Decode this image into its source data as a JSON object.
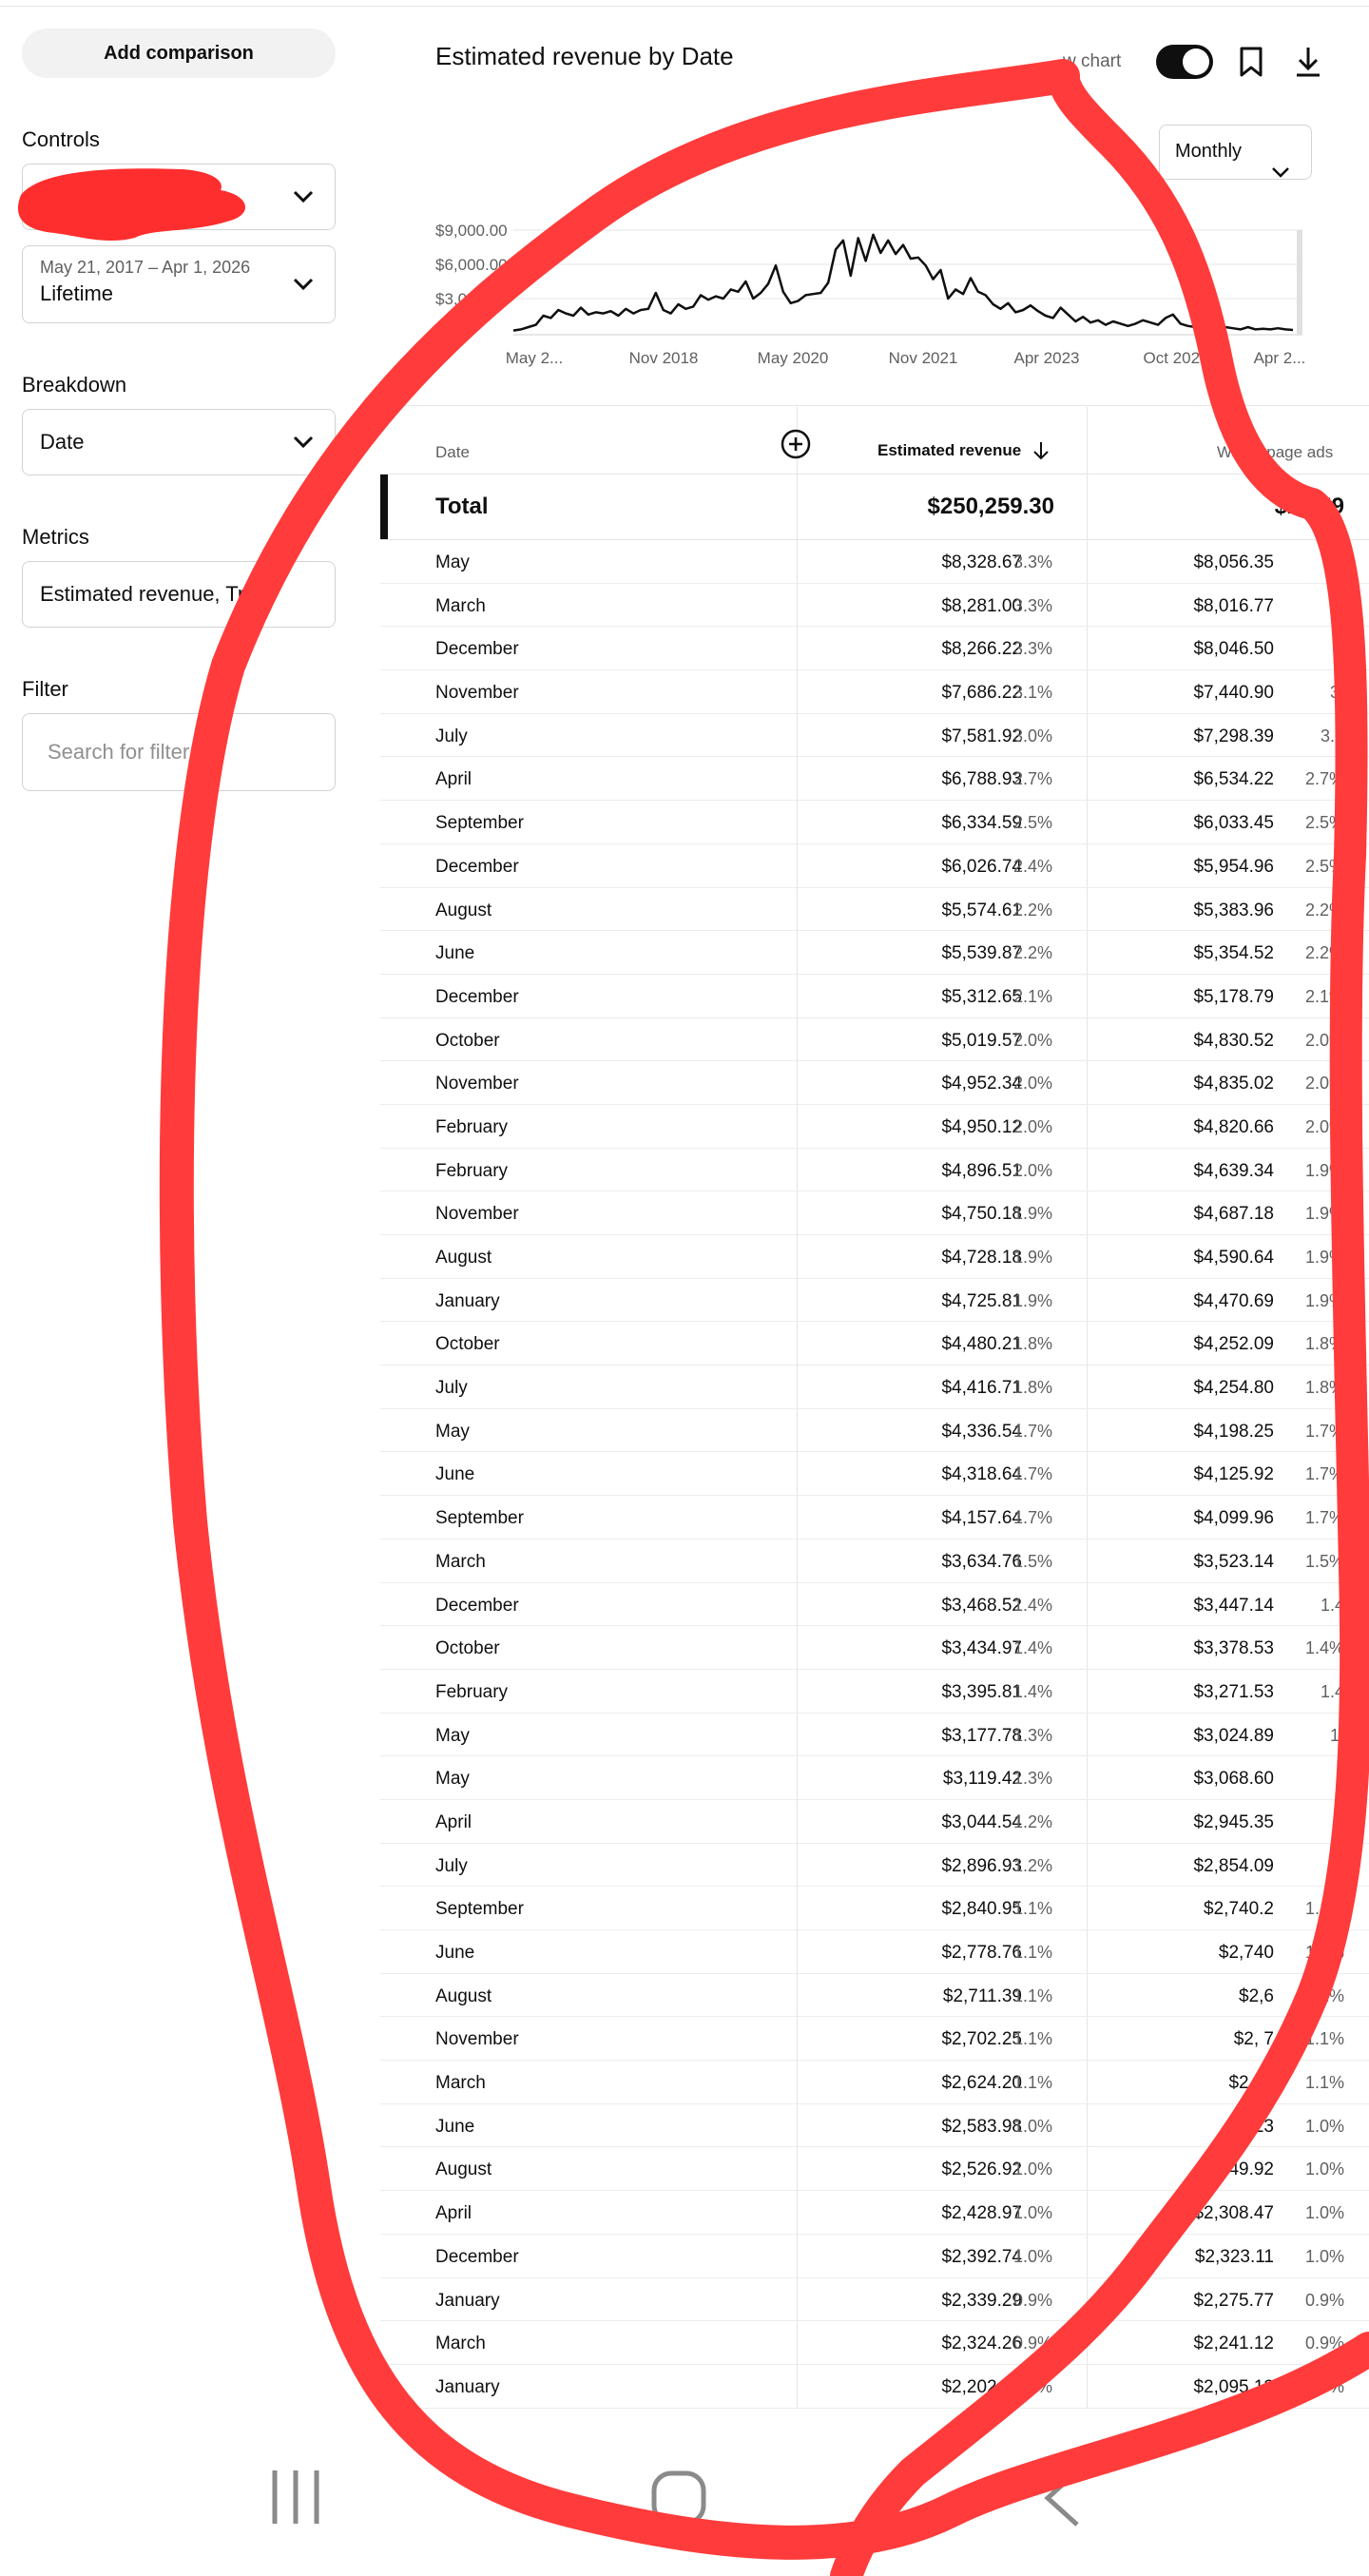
{
  "left": {
    "add_comparison": "Add comparison",
    "controls_title": "Controls",
    "date_range_small": "May 21, 2017 – Apr 1, 2026",
    "date_range_value": "Lifetime",
    "breakdown_title": "Breakdown",
    "breakdown_value": "Date",
    "metrics_title": "Metrics",
    "metrics_value": "Estimated revenue, Tr...",
    "filter_title": "Filter",
    "filter_placeholder": "Search for filter"
  },
  "chart": {
    "title": "Estimated revenue by Date",
    "show_chart_label": "w chart",
    "interval": "Monthly",
    "y_ticks": [
      "$9,000.00",
      "$6,000.00",
      "$3,000"
    ],
    "x_ticks": [
      "May 2...",
      "Nov 2018",
      "May 2020",
      "Nov 2021",
      "Apr 2023",
      "Oct 2024",
      "Apr 2..."
    ]
  },
  "chart_data": {
    "type": "line",
    "title": "Estimated revenue by Date",
    "ylim": [
      0,
      9000
    ],
    "values": [
      200,
      300,
      500,
      700,
      1500,
      1300,
      2000,
      1700,
      1500,
      2200,
      1600,
      1800,
      1700,
      1900,
      1500,
      2100,
      1700,
      2000,
      2100,
      3500,
      2000,
      1700,
      2500,
      2100,
      2300,
      3300,
      2900,
      3200,
      3000,
      3800,
      3600,
      4500,
      3000,
      3500,
      4300,
      5900,
      3600,
      2600,
      2800,
      3300,
      3400,
      3500,
      4400,
      7300,
      8100,
      5000,
      8300,
      6300,
      8600,
      7000,
      8100,
      6900,
      7700,
      6500,
      6600,
      5900,
      4700,
      5500,
      3000,
      3800,
      3400,
      4800,
      3600,
      3300,
      2500,
      2100,
      2600,
      1800,
      2000,
      2400,
      1900,
      1500,
      1300,
      2200,
      1600,
      1000,
      1400,
      900,
      1100,
      700,
      1000,
      800,
      600,
      800,
      1100,
      900,
      700,
      1300,
      1600,
      800,
      600,
      500,
      400,
      500,
      600,
      500,
      400,
      300,
      500,
      300,
      350,
      300,
      400,
      300,
      250
    ]
  },
  "table": {
    "col_date": "Date",
    "col_revenue": "Estimated revenue",
    "col_watch": "Watch page ads",
    "total_label": "Total",
    "total_revenue": "$250,259.30",
    "total_watch": "$24 59",
    "rows": [
      {
        "date": "May",
        "rev": "$8,328.67",
        "revp": "3.3%",
        "w": "$8,056.35",
        "wp": ""
      },
      {
        "date": "March",
        "rev": "$8,281.00",
        "revp": "3.3%",
        "w": "$8,016.77",
        "wp": ""
      },
      {
        "date": "December",
        "rev": "$8,266.22",
        "revp": "3.3%",
        "w": "$8,046.50",
        "wp": ""
      },
      {
        "date": "November",
        "rev": "$7,686.22",
        "revp": "3.1%",
        "w": "$7,440.90",
        "wp": "3."
      },
      {
        "date": "July",
        "rev": "$7,581.92",
        "revp": "3.0%",
        "w": "$7,298.39",
        "wp": "3.0"
      },
      {
        "date": "April",
        "rev": "$6,788.93",
        "revp": "2.7%",
        "w": "$6,534.22",
        "wp": "2.7%"
      },
      {
        "date": "September",
        "rev": "$6,334.59",
        "revp": "2.5%",
        "w": "$6,033.45",
        "wp": "2.5%"
      },
      {
        "date": "December",
        "rev": "$6,026.74",
        "revp": "2.4%",
        "w": "$5,954.96",
        "wp": "2.5%"
      },
      {
        "date": "August",
        "rev": "$5,574.61",
        "revp": "2.2%",
        "w": "$5,383.96",
        "wp": "2.2%"
      },
      {
        "date": "June",
        "rev": "$5,539.87",
        "revp": "2.2%",
        "w": "$5,354.52",
        "wp": "2.2%"
      },
      {
        "date": "December",
        "rev": "$5,312.65",
        "revp": "2.1%",
        "w": "$5,178.79",
        "wp": "2.1%"
      },
      {
        "date": "October",
        "rev": "$5,019.57",
        "revp": "2.0%",
        "w": "$4,830.52",
        "wp": "2.0%"
      },
      {
        "date": "November",
        "rev": "$4,952.34",
        "revp": "2.0%",
        "w": "$4,835.02",
        "wp": "2.0%"
      },
      {
        "date": "February",
        "rev": "$4,950.12",
        "revp": "2.0%",
        "w": "$4,820.66",
        "wp": "2.0%"
      },
      {
        "date": "February",
        "rev": "$4,896.51",
        "revp": "2.0%",
        "w": "$4,639.34",
        "wp": "1.9%"
      },
      {
        "date": "November",
        "rev": "$4,750.18",
        "revp": "1.9%",
        "w": "$4,687.18",
        "wp": "1.9%"
      },
      {
        "date": "August",
        "rev": "$4,728.18",
        "revp": "1.9%",
        "w": "$4,590.64",
        "wp": "1.9%"
      },
      {
        "date": "January",
        "rev": "$4,725.81",
        "revp": "1.9%",
        "w": "$4,470.69",
        "wp": "1.9%"
      },
      {
        "date": "October",
        "rev": "$4,480.21",
        "revp": "1.8%",
        "w": "$4,252.09",
        "wp": "1.8%"
      },
      {
        "date": "July",
        "rev": "$4,416.71",
        "revp": "1.8%",
        "w": "$4,254.80",
        "wp": "1.8%"
      },
      {
        "date": "May",
        "rev": "$4,336.54",
        "revp": "1.7%",
        "w": "$4,198.25",
        "wp": "1.7%"
      },
      {
        "date": "June",
        "rev": "$4,318.64",
        "revp": "1.7%",
        "w": "$4,125.92",
        "wp": "1.7%"
      },
      {
        "date": "September",
        "rev": "$4,157.64",
        "revp": "1.7%",
        "w": "$4,099.96",
        "wp": "1.7%"
      },
      {
        "date": "March",
        "rev": "$3,634.76",
        "revp": "1.5%",
        "w": "$3,523.14",
        "wp": "1.5%"
      },
      {
        "date": "December",
        "rev": "$3,468.52",
        "revp": "1.4%",
        "w": "$3,447.14",
        "wp": "1.4"
      },
      {
        "date": "October",
        "rev": "$3,434.97",
        "revp": "1.4%",
        "w": "$3,378.53",
        "wp": "1.4%"
      },
      {
        "date": "February",
        "rev": "$3,395.81",
        "revp": "1.4%",
        "w": "$3,271.53",
        "wp": "1.4"
      },
      {
        "date": "May",
        "rev": "$3,177.78",
        "revp": "1.3%",
        "w": "$3,024.89",
        "wp": "1."
      },
      {
        "date": "May",
        "rev": "$3,119.42",
        "revp": "1.3%",
        "w": "$3,068.60",
        "wp": ""
      },
      {
        "date": "April",
        "rev": "$3,044.54",
        "revp": "1.2%",
        "w": "$2,945.35",
        "wp": ""
      },
      {
        "date": "July",
        "rev": "$2,896.93",
        "revp": "1.2%",
        "w": "$2,854.09",
        "wp": "%"
      },
      {
        "date": "September",
        "rev": "$2,840.95",
        "revp": "1.1%",
        "w": "$2,740.2",
        "wp": "1.1%"
      },
      {
        "date": "June",
        "rev": "$2,778.76",
        "revp": "1.1%",
        "w": "$2,740",
        "wp": "1.1%"
      },
      {
        "date": "August",
        "rev": "$2,711.39",
        "revp": "1.1%",
        "w": "$2,6",
        "wp": "1.1%"
      },
      {
        "date": "November",
        "rev": "$2,702.25",
        "revp": "1.1%",
        "w": "$2, 7",
        "wp": "1.1%"
      },
      {
        "date": "March",
        "rev": "$2,624.20",
        "revp": "1.1%",
        "w": "$2 52",
        "wp": "1.1%"
      },
      {
        "date": "June",
        "rev": "$2,583.98",
        "revp": "1.0%",
        "w": ".23",
        "wp": "1.0%"
      },
      {
        "date": "August",
        "rev": "$2,526.92",
        "revp": "1.0%",
        "w": ",349.92",
        "wp": "1.0%"
      },
      {
        "date": "April",
        "rev": "$2,428.97",
        "revp": "1.0%",
        "w": "$2,308.47",
        "wp": "1.0%"
      },
      {
        "date": "December",
        "rev": "$2,392.74",
        "revp": "1.0%",
        "w": "$2,323.11",
        "wp": "1.0%"
      },
      {
        "date": "January",
        "rev": "$2,339.29",
        "revp": "0.9%",
        "w": "$2,275.77",
        "wp": "0.9%"
      },
      {
        "date": "March",
        "rev": "$2,324.26",
        "revp": "0.9%",
        "w": "$2,241.12",
        "wp": "0.9%"
      },
      {
        "date": "January",
        "rev": "$2,202.52",
        "revp": "0.9%",
        "w": "$2,095.13",
        "wp": "0.9%"
      }
    ]
  },
  "colors": {
    "accent": "#0f0f0f",
    "scribble": "#ff3b3b"
  }
}
